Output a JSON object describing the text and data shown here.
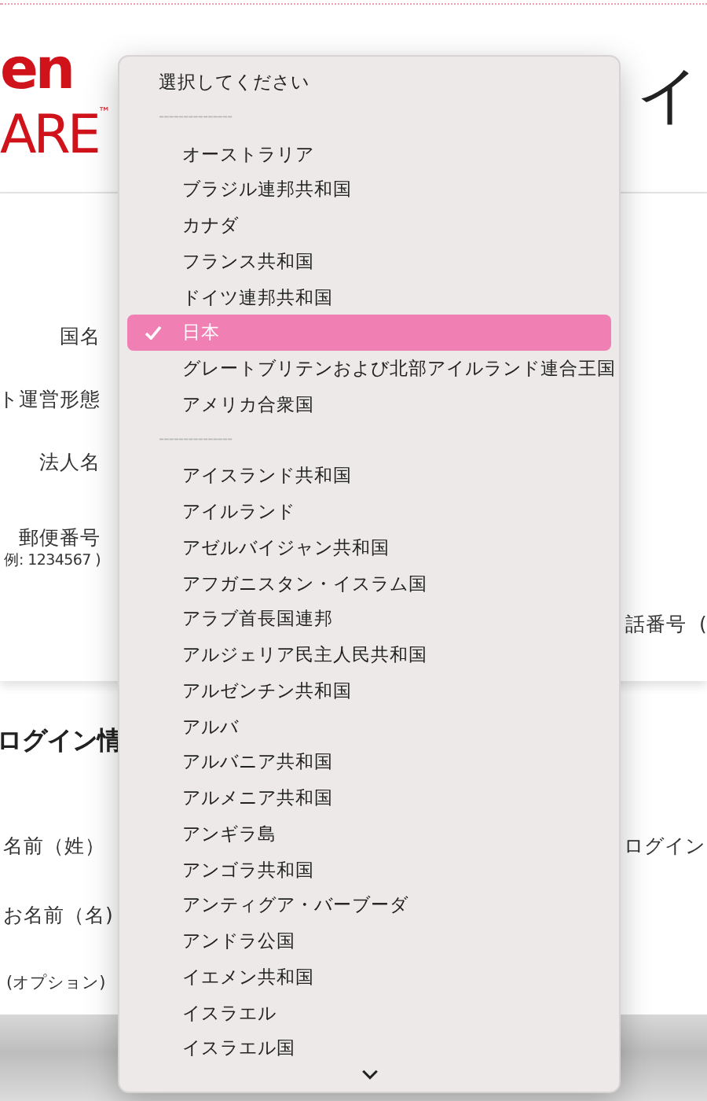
{
  "logo": {
    "line_1": "en",
    "line_2": "ARE",
    "mark": "™"
  },
  "heading": "イ",
  "company_form": {
    "labels": [
      {
        "text": "国名"
      },
      {
        "text": "ト運営形態"
      },
      {
        "text": "法人名"
      },
      {
        "text": "郵便番号",
        "hint": "例: 1234567 )"
      }
    ],
    "phone_label": "話番号",
    "phone_hint": "("
  },
  "login_section": {
    "title": "ログイン情",
    "labels": [
      {
        "text": "名前（姓）"
      },
      {
        "text": "お名前（名)"
      },
      {
        "text": "(オプション)"
      }
    ],
    "right_label": "ログイン"
  },
  "country_menu": {
    "items": [
      {
        "kind": "placeholder",
        "label": "選択してください"
      },
      {
        "kind": "separator",
        "label": "---------------"
      },
      {
        "kind": "option",
        "label": "オーストラリア",
        "selected": false
      },
      {
        "kind": "option",
        "label": "ブラジル連邦共和国",
        "selected": false
      },
      {
        "kind": "option",
        "label": "カナダ",
        "selected": false
      },
      {
        "kind": "option",
        "label": "フランス共和国",
        "selected": false
      },
      {
        "kind": "option",
        "label": "ドイツ連邦共和国",
        "selected": false
      },
      {
        "kind": "option",
        "label": "日本",
        "selected": true
      },
      {
        "kind": "option",
        "label": "グレートブリテンおよび北部アイルランド連合王国",
        "selected": false
      },
      {
        "kind": "option",
        "label": "アメリカ合衆国",
        "selected": false
      },
      {
        "kind": "separator",
        "label": "---------------"
      },
      {
        "kind": "option",
        "label": "アイスランド共和国",
        "selected": false
      },
      {
        "kind": "option",
        "label": "アイルランド",
        "selected": false
      },
      {
        "kind": "option",
        "label": "アゼルバイジャン共和国",
        "selected": false
      },
      {
        "kind": "option",
        "label": "アフガニスタン・イスラム国",
        "selected": false
      },
      {
        "kind": "option",
        "label": "アラブ首長国連邦",
        "selected": false
      },
      {
        "kind": "option",
        "label": "アルジェリア民主人民共和国",
        "selected": false
      },
      {
        "kind": "option",
        "label": "アルゼンチン共和国",
        "selected": false
      },
      {
        "kind": "option",
        "label": "アルバ",
        "selected": false
      },
      {
        "kind": "option",
        "label": "アルバニア共和国",
        "selected": false
      },
      {
        "kind": "option",
        "label": "アルメニア共和国",
        "selected": false
      },
      {
        "kind": "option",
        "label": "アンギラ島",
        "selected": false
      },
      {
        "kind": "option",
        "label": "アンゴラ共和国",
        "selected": false
      },
      {
        "kind": "option",
        "label": "アンティグア・バーブーダ",
        "selected": false
      },
      {
        "kind": "option",
        "label": "アンドラ公国",
        "selected": false
      },
      {
        "kind": "option",
        "label": "イエメン共和国",
        "selected": false
      },
      {
        "kind": "option",
        "label": "イスラエル",
        "selected": false
      },
      {
        "kind": "option",
        "label": "イスラエル国",
        "selected": false
      }
    ]
  }
}
